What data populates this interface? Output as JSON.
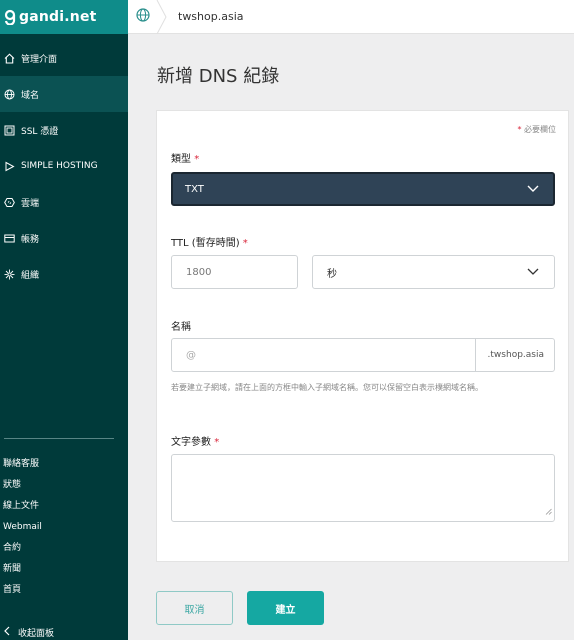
{
  "brand": {
    "name": "gandi.net"
  },
  "sidebar": {
    "items": [
      {
        "label": "管理介面",
        "icon": "home-icon",
        "active": false
      },
      {
        "label": "域名",
        "icon": "globe-icon",
        "active": true
      },
      {
        "label": "SSL 憑證",
        "icon": "certificate-icon",
        "active": false
      },
      {
        "label": "SIMPLE HOSTING",
        "icon": "play-icon",
        "active": false
      },
      {
        "label": "雲端",
        "icon": "cloud-icon",
        "active": false
      },
      {
        "label": "帳務",
        "icon": "card-icon",
        "active": false
      },
      {
        "label": "組織",
        "icon": "organization-icon",
        "active": false
      }
    ],
    "footer_links": [
      "聯絡客服",
      "狀態",
      "線上文件",
      "Webmail",
      "合約",
      "新聞",
      "首頁"
    ],
    "collapse_label": "收起面板"
  },
  "topbar": {
    "domain": "twshop.asia"
  },
  "page": {
    "title": "新增 DNS 紀錄"
  },
  "form": {
    "required_note": "必要欄位",
    "type": {
      "label": "類型",
      "value": "TXT"
    },
    "ttl": {
      "label": "TTL (暫存時間)",
      "value": "1800",
      "unit": "秒"
    },
    "name": {
      "label": "名稱",
      "placeholder": "@",
      "suffix": ".twshop.asia",
      "hint": "若要建立子網域，請在上面的方框中輸入子網域名稱。您可以保留空白表示樸網域名稱。"
    },
    "text_value": {
      "label": "文字參數",
      "value": ""
    }
  },
  "actions": {
    "cancel": "取消",
    "create": "建立"
  },
  "colors": {
    "sidebar_bg": "#003a3a",
    "brand_bg": "#0f8c8a",
    "accent": "#15a8a2",
    "select_bg": "#2f4356",
    "required": "#d9263b"
  }
}
